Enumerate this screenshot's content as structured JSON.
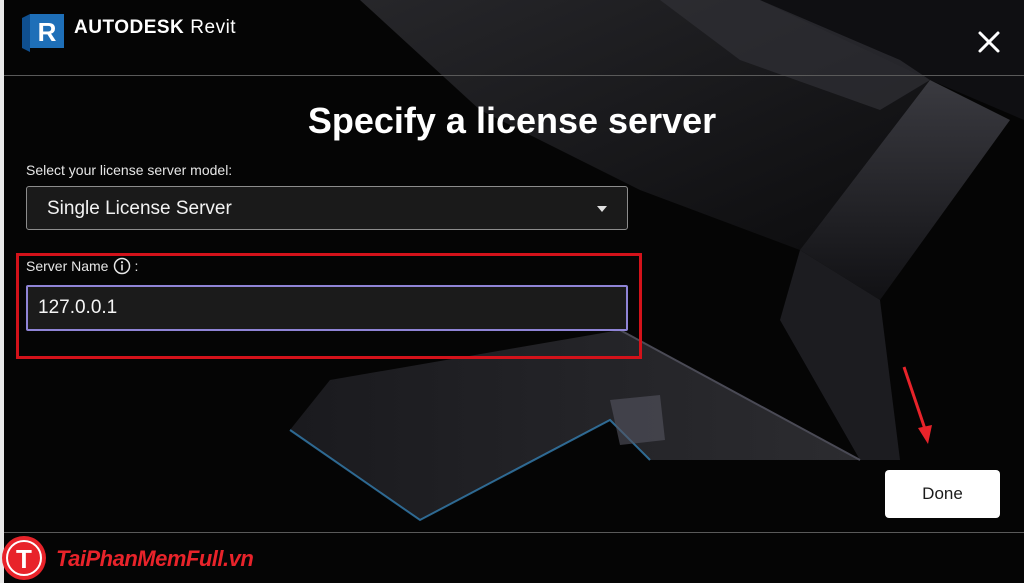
{
  "app": {
    "brand": "AUTODESK",
    "product": "Revit",
    "logo_letter": "R"
  },
  "dialog": {
    "title": "Specify a license server",
    "model_label": "Select your license server model:",
    "model_value": "Single License Server",
    "server_name_label": "Server Name",
    "server_name_suffix": ":",
    "server_name_value": "127.0.0.1",
    "done_label": "Done"
  },
  "icons": {
    "close": "close-icon",
    "caret": "chevron-down-icon",
    "info": "info-icon",
    "annotation": "red-arrow-annotation"
  },
  "colors": {
    "accent_blue": "#1e6fb8",
    "highlight_red": "#d3121a",
    "input_border": "#8f84d6",
    "watermark_red": "#e8232a"
  },
  "watermark": {
    "text": "TaiPhanMemFull.vn",
    "letter": "T"
  }
}
